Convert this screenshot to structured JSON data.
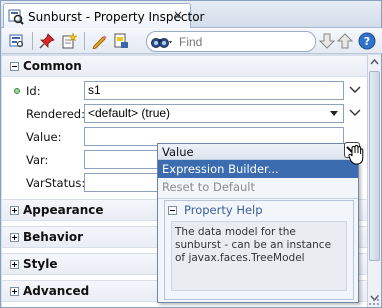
{
  "window": {
    "tab_title": "Sunburst - Property Inspector",
    "close_glyph": "×"
  },
  "toolbar": {
    "search_placeholder": "Find",
    "icons": [
      "inspector-icon",
      "pin-icon",
      "new-page-icon",
      "edit-pencil-icon",
      "binding-icon",
      "binoculars-icon",
      "arrow-down-icon",
      "arrow-up-icon",
      "help-icon"
    ]
  },
  "sections": {
    "common": "Common",
    "appearance": "Appearance",
    "behavior": "Behavior",
    "style": "Style",
    "advanced": "Advanced"
  },
  "properties": {
    "id": {
      "label": "Id:",
      "value": "s1"
    },
    "rendered": {
      "label": "Rendered:",
      "value": "<default> (true)"
    },
    "value": {
      "label": "Value:",
      "value": ""
    },
    "var": {
      "label": "Var:",
      "value": ""
    },
    "varstatus": {
      "label": "VarStatus:",
      "value": ""
    }
  },
  "popup": {
    "header": "Value",
    "items": [
      "Expression Builder...",
      "Reset to Default"
    ],
    "help_title": "Property Help",
    "help_text": "The data model for the sunburst - can be an instance of javax.faces.TreeModel"
  },
  "colors": {
    "accent": "#3b6cb0",
    "frame": "#d6e0ec",
    "required": "#3c8a3c"
  }
}
